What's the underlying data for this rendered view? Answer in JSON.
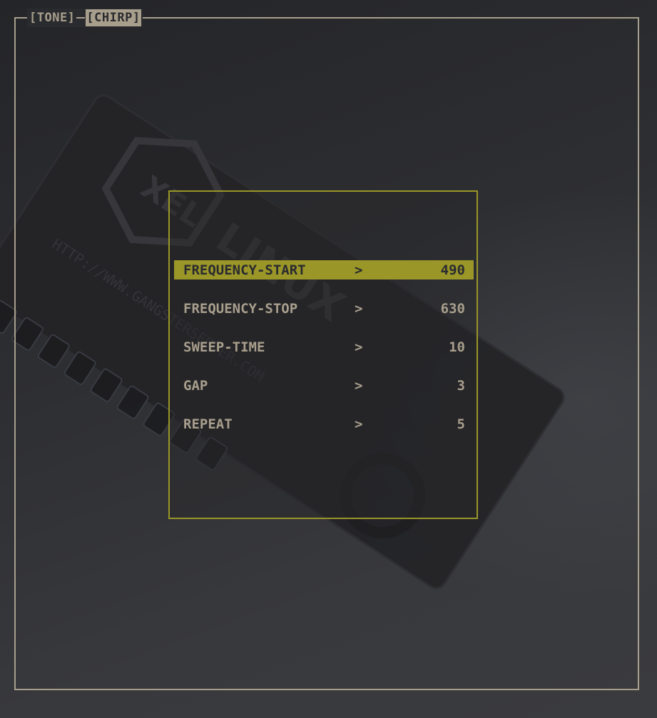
{
  "tabs": [
    {
      "label": "[TONE]",
      "active": false
    },
    {
      "label": "[CHIRP]",
      "active": true
    }
  ],
  "menu": {
    "arrow": ">",
    "items": [
      {
        "label": "FREQUENCY-START",
        "value": "490",
        "selected": true
      },
      {
        "label": "FREQUENCY-STOP",
        "value": "630",
        "selected": false
      },
      {
        "label": "SWEEP-TIME",
        "value": "10",
        "selected": false
      },
      {
        "label": "GAP",
        "value": "3",
        "selected": false
      },
      {
        "label": "REPEAT",
        "value": "5",
        "selected": false
      }
    ]
  },
  "wallpaper": {
    "logo_text": "XEL",
    "brand_text": "LINUX",
    "url_text": "HTTP://WWW.GANGSTERSERVER.COM"
  },
  "colors": {
    "frame": "#a89e8c",
    "accent": "#9a9628",
    "background": "#2b2c30"
  }
}
